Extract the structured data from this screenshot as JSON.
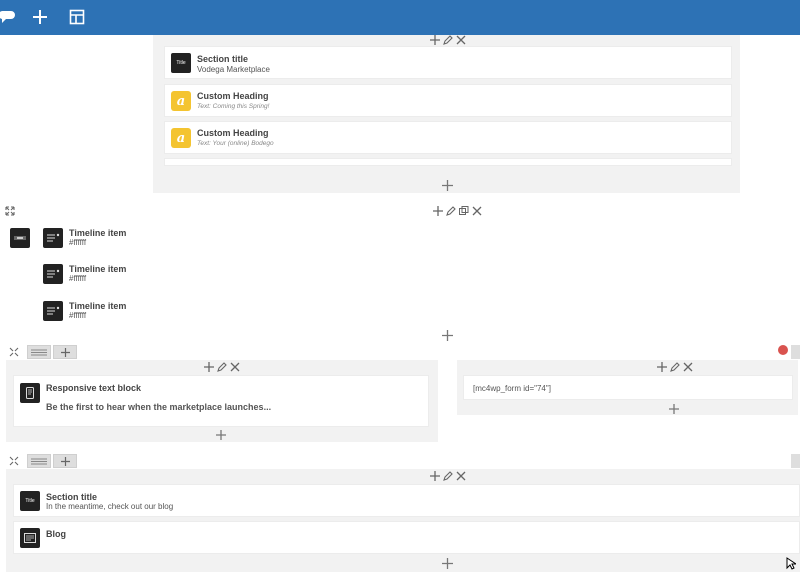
{
  "toolbar": {
    "icons": [
      "bubble-icon",
      "plus-icon",
      "layout-icon"
    ]
  },
  "sections": {
    "top": {
      "items": [
        {
          "title": "Section title",
          "subtitle": "Vodega Marketplace",
          "thumb_label": "Title"
        },
        {
          "title": "Custom Heading",
          "subtitle": "Text: Coming this Spring!",
          "thumb_label": "a"
        },
        {
          "title": "Custom Heading",
          "subtitle": "Text: Your (online) Bodego",
          "thumb_label": "a"
        }
      ]
    },
    "timeline": {
      "items": [
        {
          "title": "Timeline item",
          "subtitle": "#ffffff"
        },
        {
          "title": "Timeline item",
          "subtitle": "#ffffff"
        },
        {
          "title": "Timeline item",
          "subtitle": "#ffffff"
        }
      ]
    },
    "row3": {
      "left": {
        "title": "Responsive text block",
        "text": "Be the first to hear when the marketplace launches..."
      },
      "right": {
        "shortcode": "[mc4wp_form id=\"74\"]"
      }
    },
    "row4": {
      "items": [
        {
          "title": "Section title",
          "subtitle": "In the meantime, check out our blog",
          "thumb_label": "Title"
        },
        {
          "title": "Blog",
          "subtitle": ""
        }
      ]
    }
  },
  "colors": {
    "topbar": "#2d72b5",
    "yellow": "#f4c430",
    "red_dot": "#d9534f"
  }
}
